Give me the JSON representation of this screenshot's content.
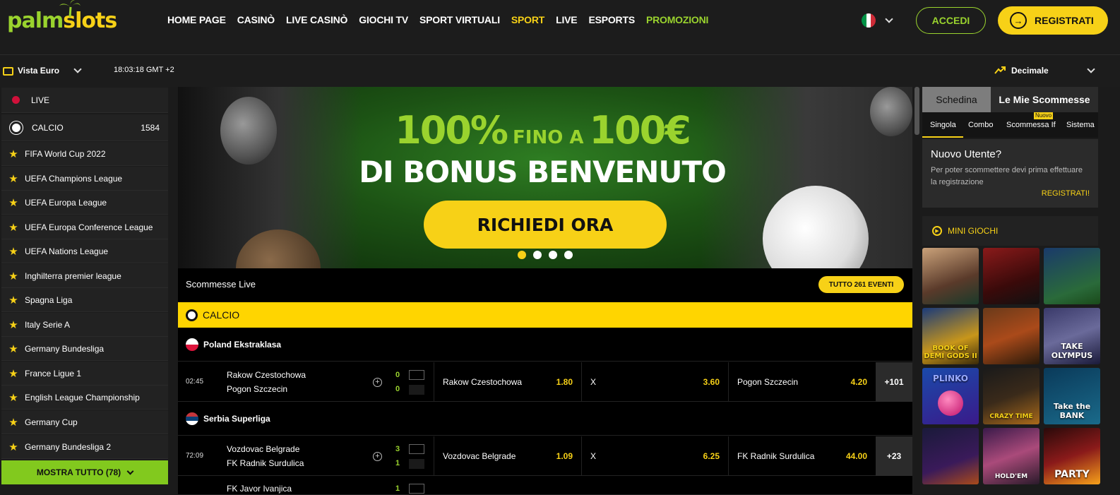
{
  "brand": {
    "part1": "palm",
    "part2": "slots"
  },
  "nav": [
    "HOME PAGE",
    "CASINÒ",
    "LIVE CASINÒ",
    "GIOCHI TV",
    "SPORT VIRTUALI",
    "SPORT",
    "LIVE",
    "ESPORTS",
    "PROMOZIONI"
  ],
  "nav_colors": {
    "SPORT": "#f7d117",
    "PROMOZIONI": "#9ad32e"
  },
  "header": {
    "login": "ACCEDI",
    "register": "REGISTRATI"
  },
  "subbar": {
    "view": "Vista Euro",
    "clock": "18:03:18 GMT +2",
    "odds_format": "Decimale"
  },
  "sidebar": {
    "live": "LIVE",
    "calcio": {
      "label": "CALCIO",
      "count": "1584"
    },
    "leagues": [
      "FIFA World Cup 2022",
      "UEFA Champions League",
      "UEFA Europa League",
      "UEFA Europa Conference League",
      "UEFA Nations League",
      "Inghilterra premier league",
      "Spagna Liga",
      "Italy Serie A",
      "Germany Bundesliga",
      "France Ligue 1",
      "English League Championship",
      "Germany Cup",
      "Germany Bundesliga 2"
    ],
    "show_all": "MOSTRA TUTTO (78)"
  },
  "banner": {
    "pct": "100%",
    "fino": "FINO A",
    "amount": "100€",
    "line2": "DI BONUS BENVENUTO",
    "cta": "RICHIEDI ORA",
    "slides": 4,
    "active_slide": 1
  },
  "live": {
    "title": "Scommesse Live",
    "all_events": "TUTTO 261 EVENTI",
    "sport": "CALCIO",
    "groups": [
      {
        "league": "Poland Ekstraklasa",
        "match": {
          "time": "02:45",
          "home": "Rakow Czestochowa",
          "away": "Pogon Szczecin",
          "score_home": "0",
          "score_away": "0",
          "odds": [
            {
              "label": "Rakow Czestochowa",
              "value": "1.80"
            },
            {
              "label": "X",
              "value": "3.60"
            },
            {
              "label": "Pogon Szczecin",
              "value": "4.20"
            }
          ],
          "more": "+101"
        }
      },
      {
        "league": "Serbia Superliga",
        "match": {
          "time": "72:09",
          "home": "Vozdovac Belgrade",
          "away": "FK Radnik Surdulica",
          "score_home": "3",
          "score_away": "1",
          "odds": [
            {
              "label": "Vozdovac Belgrade",
              "value": "1.09"
            },
            {
              "label": "X",
              "value": "6.25"
            },
            {
              "label": "FK Radnik Surdulica",
              "value": "44.00"
            }
          ],
          "more": "+23"
        }
      }
    ],
    "partial_match": {
      "home": "FK Javor Ivanjica",
      "score_home": "1"
    }
  },
  "betslip": {
    "tab_active": "Schedina",
    "tab_other": "Le Mie Scommesse",
    "subtabs": [
      "Singola",
      "Combo",
      "Scommessa If",
      "Sistema"
    ],
    "new_badge": "Nuovo",
    "new_user_title": "Nuovo Utente?",
    "new_user_text": "Per poter scommettere devi prima effettuare la registrazione",
    "register_link": "REGISTRATI!"
  },
  "mini_games": {
    "title": "MINI GIOCHI",
    "tiles": [
      "",
      "",
      "",
      "BOOK OF DEMI GODS II",
      "",
      "TAKE OLYMPUS",
      "PLINKO",
      "CRAZY TIME",
      "Take the BANK",
      "",
      "HOLD'EM",
      "PARTY"
    ]
  }
}
